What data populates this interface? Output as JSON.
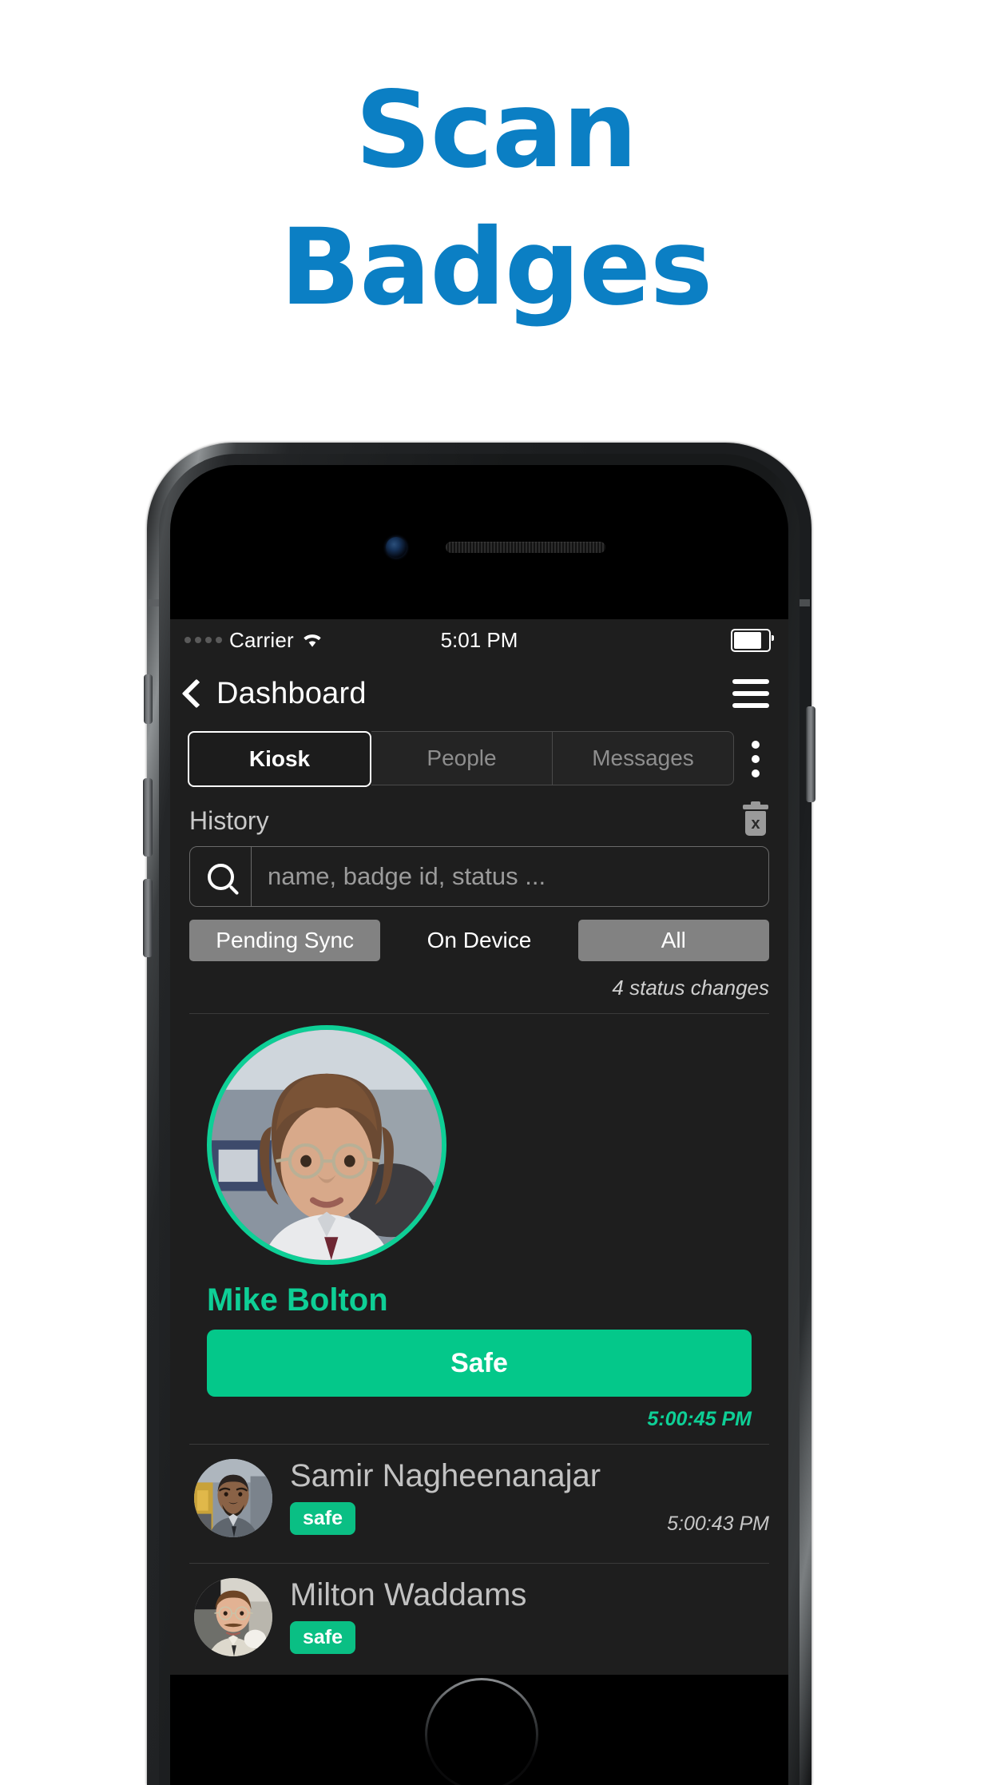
{
  "headline": {
    "line1": "Scan",
    "line2": "Badges",
    "color": "#0b7fc4"
  },
  "status_bar": {
    "carrier": "Carrier",
    "time": "5:01 PM",
    "wifi_icon": "wifi-icon",
    "battery_icon": "battery-icon",
    "signal_icon": "signal-dots-icon"
  },
  "nav_bar": {
    "back_label": "Dashboard",
    "back_icon": "chevron-left-icon",
    "menu_icon": "hamburger-menu-icon"
  },
  "segments": {
    "items": [
      {
        "label": "Kiosk",
        "active": true
      },
      {
        "label": "People",
        "active": false
      },
      {
        "label": "Messages",
        "active": false
      }
    ],
    "overflow_icon": "kebab-menu-icon"
  },
  "history": {
    "label": "History",
    "clear_icon": "trash-delete-icon",
    "clear_glyph": "x"
  },
  "search": {
    "icon": "search-icon",
    "value": "",
    "placeholder": "name, badge id, status ..."
  },
  "filters": [
    {
      "label": "Pending Sync",
      "selected": true
    },
    {
      "label": "On Device",
      "selected": false
    },
    {
      "label": "All",
      "selected": true
    }
  ],
  "summary": {
    "count_text": "4 status changes"
  },
  "featured": {
    "name": "Mike Bolton",
    "status_label": "Safe",
    "time": "5:00:45 PM",
    "accent_color": "#0ECF96",
    "button_color": "#04C88A"
  },
  "entries": [
    {
      "name": "Samir Nagheenanajar",
      "status": "safe",
      "time": "5:00:43 PM"
    },
    {
      "name": "Milton Waddams",
      "status": "safe",
      "time": ""
    }
  ],
  "colors": {
    "screen_bg": "#1e1e1e",
    "green": "#0ECF96",
    "blue": "#0b7fc4"
  }
}
